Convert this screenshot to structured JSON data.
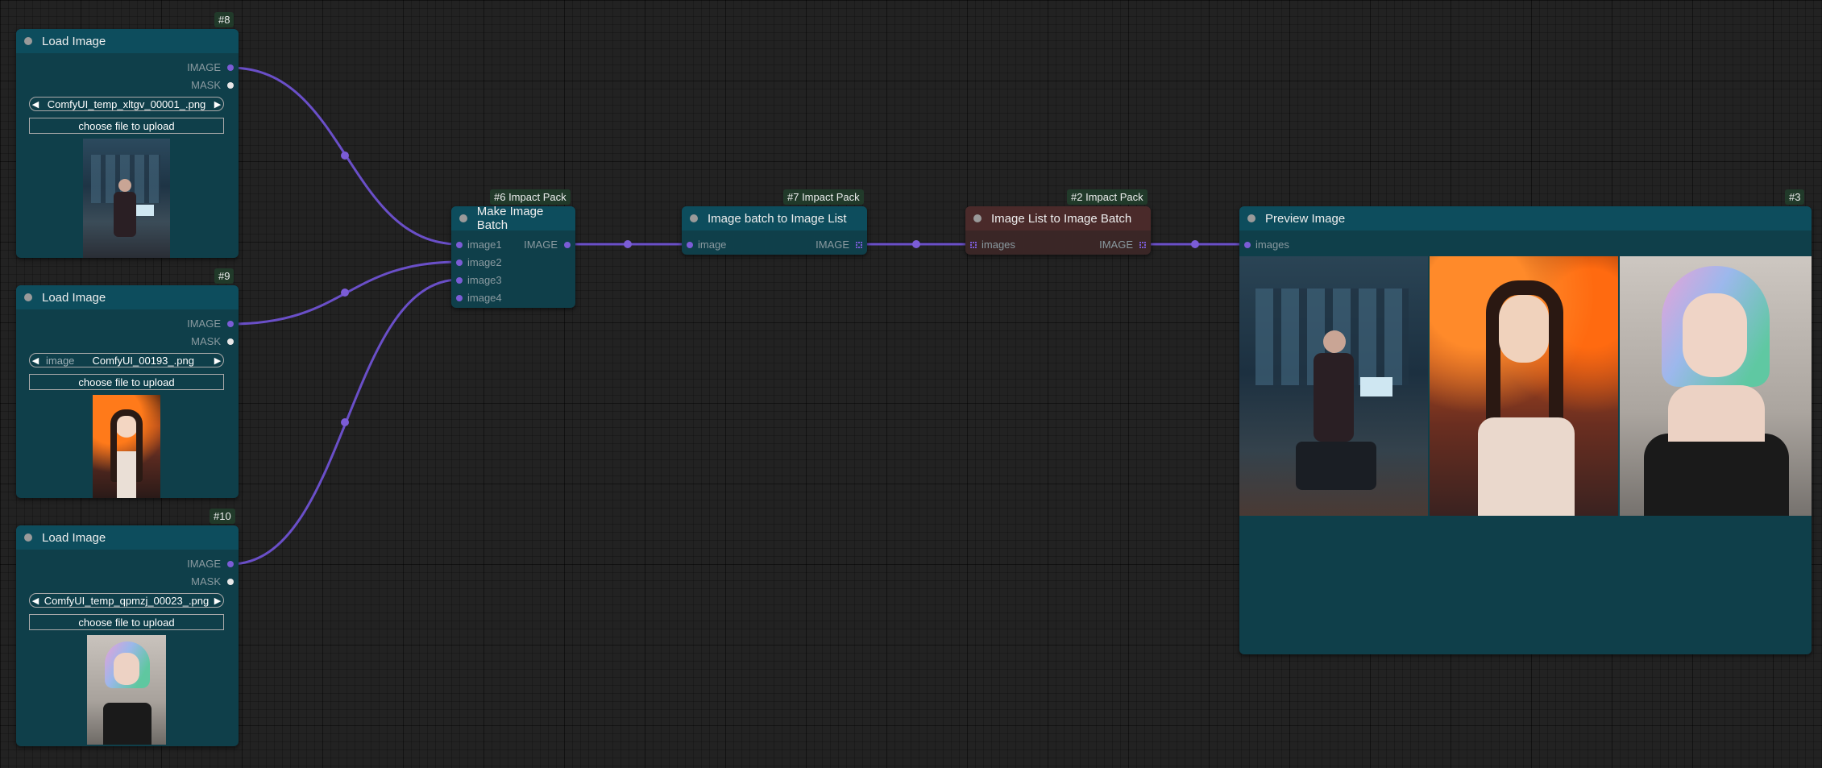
{
  "colors": {
    "canvas": "#222222",
    "node_body": "#0f3f4a",
    "node_title": "#0d4d5d",
    "link_image": "#7b5cd6"
  },
  "nodes": {
    "load8": {
      "id": "#8",
      "title": "Load Image",
      "out_image": "IMAGE",
      "out_mask": "MASK",
      "combo_label": "image",
      "combo_value": "ComfyUI_temp_xltgv_00001_.png",
      "button": "choose file to upload"
    },
    "load9": {
      "id": "#9",
      "title": "Load Image",
      "out_image": "IMAGE",
      "out_mask": "MASK",
      "combo_label": "image",
      "combo_value": "ComfyUI_00193_.png",
      "button": "choose file to upload"
    },
    "load10": {
      "id": "#10",
      "title": "Load Image",
      "out_image": "IMAGE",
      "out_mask": "MASK",
      "combo_label": "image",
      "combo_value": "ComfyUI_temp_qpmzj_00023_.png",
      "button": "choose file to upload"
    },
    "batch6": {
      "id": "#6 Impact Pack",
      "title": "Make Image Batch",
      "inputs": [
        "image1",
        "image2",
        "image3",
        "image4"
      ],
      "output": "IMAGE"
    },
    "list7": {
      "id": "#7 Impact Pack",
      "title": "Image batch to Image List",
      "input": "image",
      "output": "IMAGE"
    },
    "list2": {
      "id": "#2 Impact Pack",
      "title": "Image List to Image Batch",
      "input": "images",
      "output": "IMAGE"
    },
    "preview3": {
      "id": "#3",
      "title": "Preview Image",
      "input": "images"
    }
  }
}
